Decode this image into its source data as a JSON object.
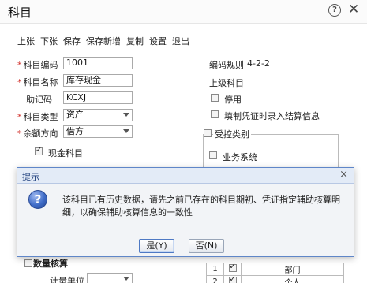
{
  "window": {
    "title": "科目",
    "help_icon": "?",
    "close_icon": "✕"
  },
  "toolbar": [
    "上张",
    "下张",
    "保存",
    "保存新增",
    "复制",
    "设置",
    "退出"
  ],
  "form": {
    "code_label": "科目编码",
    "code_value": "1001",
    "name_label": "科目名称",
    "name_value": "库存现金",
    "mnemonic_label": "助记码",
    "mnemonic_value": "KCXJ",
    "type_label": "科目类型",
    "type_value": "资产",
    "balance_label": "余额方向",
    "balance_value": "借方",
    "cash_label": "现金科目",
    "coding_rule_label": "编码规则",
    "coding_rule_value": "4-2-2",
    "parent_label": "上级科目",
    "disable_label": "停用",
    "voucher_label": "填制凭证时录入结算信息",
    "controlled_label": "受控类别",
    "business_system_label": "业务系统",
    "quantity_label": "数量核算",
    "unit_label": "计量单位"
  },
  "table": {
    "rows": [
      {
        "index": "1",
        "name": "部门"
      },
      {
        "index": "2",
        "name": "个人"
      }
    ]
  },
  "dialog": {
    "title": "提示",
    "close": "×",
    "icon": "?",
    "message": "该科目已有历史数据，请先之前已存在的科目期初、凭证指定辅助核算明细，以确保辅助核算信息的一致性",
    "yes_label": "是(Y)",
    "no_label": "否(N)"
  }
}
